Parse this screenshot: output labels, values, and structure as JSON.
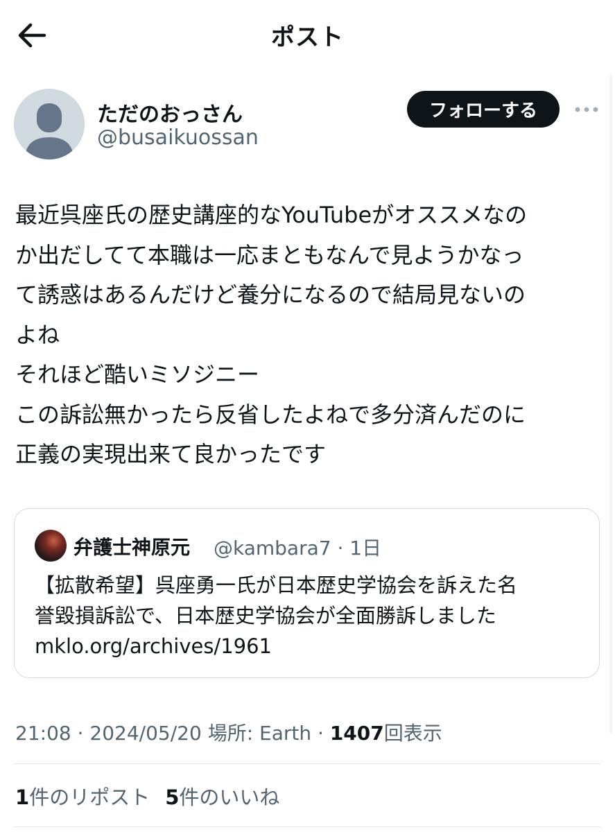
{
  "header": {
    "title": "ポスト"
  },
  "author": {
    "display_name": "ただのおっさん",
    "handle": "@busaikuossan",
    "follow_label": "フォローする"
  },
  "post": {
    "lines": [
      "最近呉座氏の歴史講座的なYouTubeがオススメなの",
      "か出だしてて本職は一応まともなんで見ようかなっ",
      "て誘惑はあるんだけど養分になるので結局見ないの",
      "よね",
      "それほど酷いミソジニー",
      "この訴訟無かったら反省したよねで多分済んだのに",
      "正義の実現出来て良かったです"
    ]
  },
  "quote": {
    "display_name": "弁護士神原元",
    "handle": "@kambara7",
    "time": "1日",
    "lines": [
      "【拡散希望】呉座勇一氏が日本歴史学協会を訴えた名",
      "誉毀損訴訟で、日本歴史学協会が全面勝訴しました",
      "mklo.org/archives/1961"
    ]
  },
  "meta": {
    "time": "21:08",
    "date": "2024/05/20",
    "location": "場所: Earth",
    "views": "1407",
    "views_label": "回表示"
  },
  "stats": {
    "reposts": "1",
    "reposts_label": "件のリポスト",
    "likes": "5",
    "likes_label": "件のいいね"
  }
}
